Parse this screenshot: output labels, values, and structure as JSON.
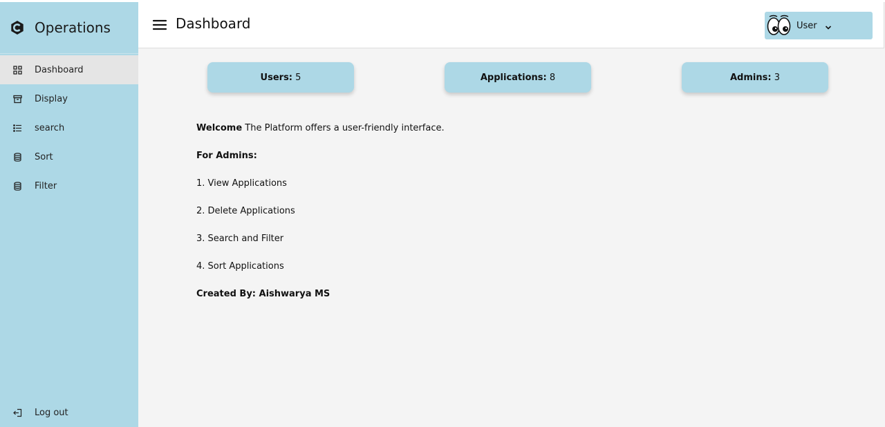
{
  "sidebar": {
    "brand": "Operations",
    "items": [
      {
        "label": "Dashboard",
        "icon": "grid-icon",
        "active": true
      },
      {
        "label": "Display",
        "icon": "archive-icon"
      },
      {
        "label": "search",
        "icon": "list-icon"
      },
      {
        "label": "Sort",
        "icon": "database-icon"
      },
      {
        "label": "Filter",
        "icon": "database-icon"
      }
    ],
    "logout": "Log out"
  },
  "header": {
    "title": "Dashboard",
    "user": "User"
  },
  "stats": [
    {
      "label": "Users:",
      "value": "5"
    },
    {
      "label": "Applications:",
      "value": "8"
    },
    {
      "label": "Admins:",
      "value": "3"
    }
  ],
  "content": {
    "welcome_bold": "Welcome",
    "welcome_text": " The Platform offers a user-friendly interface.",
    "admins_heading": "For Admins:",
    "list": [
      "1. View Applications",
      "2. Delete Applications",
      "3. Search and Filter",
      "4. Sort Applications"
    ],
    "created_by": "Created By: Aishwarya MS"
  },
  "colors": {
    "accent": "#add8e6",
    "background": "#f4f4f4",
    "active_item": "#e5e5e5"
  }
}
